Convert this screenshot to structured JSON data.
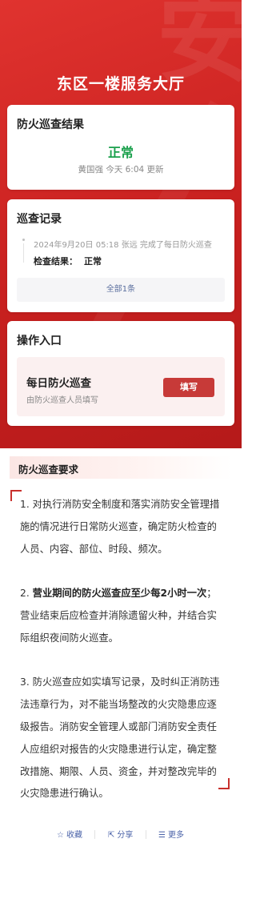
{
  "page": {
    "title": "东区一楼服务大厅",
    "watermark": "安"
  },
  "result_card": {
    "title": "防火巡查结果",
    "status": "正常",
    "meta": "黄国强 今天 6:04 更新",
    "status_color": "#1aa04c"
  },
  "record_card": {
    "title": "巡查记录",
    "records": [
      {
        "text": "2024年9月20日 05:18  张远  完成了每日防火巡查",
        "result_label": "检查结果：",
        "result_value": "正常"
      }
    ],
    "all_label": "全部1条"
  },
  "op_card": {
    "title": "操作入口",
    "item_name": "每日防火巡查",
    "item_desc": "由防火巡查人员填写",
    "button_label": "填写"
  },
  "requirements": {
    "header": "防火巡查要求",
    "p1": "1. 对执行消防安全制度和落实消防安全管理措施的情况进行日常防火巡查，确定防火检查的人员、内容、部位、时段、频次。",
    "p2_prefix": "2. ",
    "p2_bold": "营业期间的防火巡查应至少每2小时一次",
    "p2_rest": "；营业结束后应检查并消除遗留火种，并结合实际组织夜间防火巡查。",
    "p3": "3. 防火巡查应如实填写记录，及时纠正消防违法违章行为，对不能当场整改的火灾隐患应逐级报告。消防安全管理人或部门消防安全责任人应组织对报告的火灾隐患进行认定，确定整改措施、期限、人员、资金，并对整改完毕的火灾隐患进行确认。"
  },
  "actions": {
    "favorite": {
      "label": "收藏",
      "icon": "star-icon",
      "glyph": "☆"
    },
    "share": {
      "label": "分享",
      "icon": "share-icon",
      "glyph": "⇱"
    },
    "more": {
      "label": "更多",
      "icon": "menu-icon",
      "glyph": "☰"
    }
  },
  "colors": {
    "brand_red": "#c8201f",
    "button_red": "#c73a38",
    "link_blue": "#4a62a8"
  }
}
